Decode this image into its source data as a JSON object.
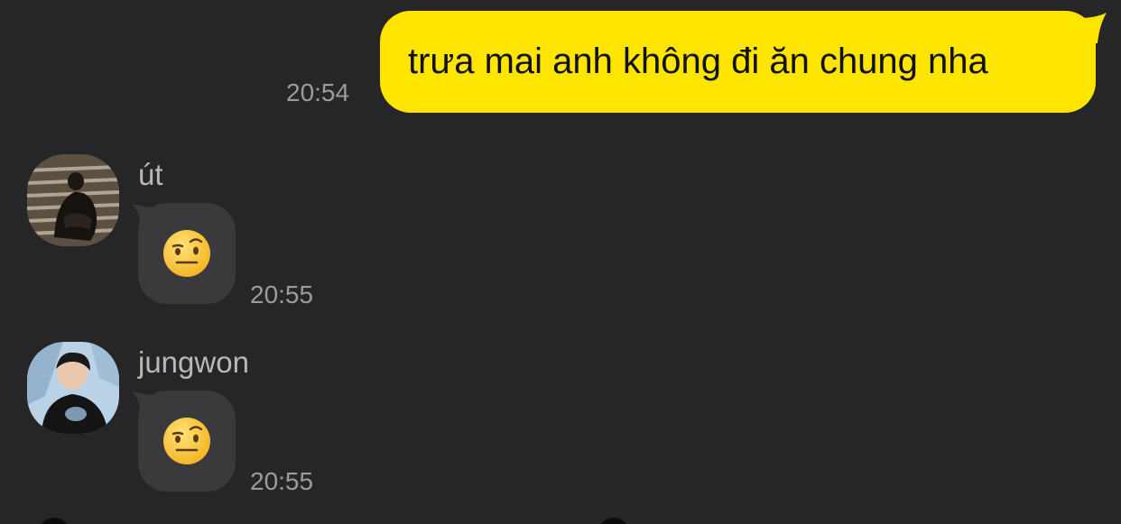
{
  "messages": [
    {
      "direction": "outgoing",
      "text": "trưa mai anh không đi ăn chung nha",
      "time": "20:54",
      "bubble_color": "#FEE500"
    },
    {
      "direction": "incoming",
      "sender": "út",
      "content": "face-with-raised-eyebrow-emoji",
      "time": "20:55",
      "avatar": "sender-avatar-photo"
    },
    {
      "direction": "incoming",
      "sender": "jungwon",
      "content": "face-with-raised-eyebrow-emoji",
      "time": "20:55",
      "avatar": "sender-avatar-photo"
    }
  ],
  "colors": {
    "background": "#262628",
    "incoming_bubble": "#3a3a3c",
    "timestamp": "#9c9ca0",
    "sender_name": "#b8b8bc"
  }
}
